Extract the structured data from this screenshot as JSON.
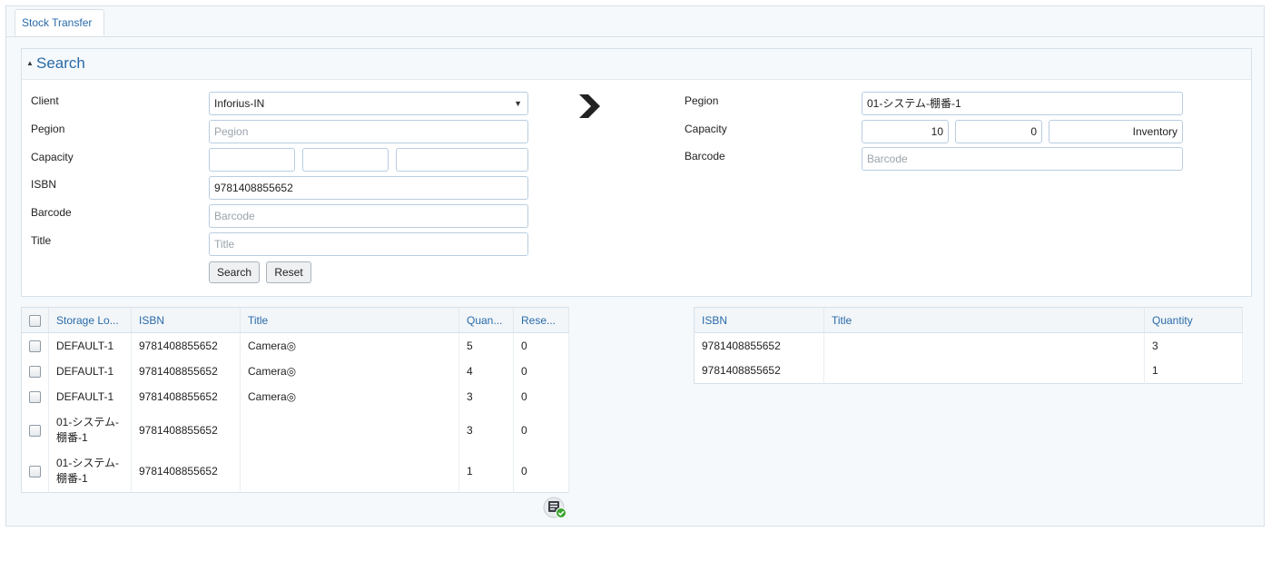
{
  "tab": {
    "label": "Stock Transfer"
  },
  "search_panel": {
    "title": "Search",
    "caret": "▲"
  },
  "left_form": {
    "client_label": "Client",
    "client_value": "Inforius-IN",
    "client_arrow": "▼",
    "pegion_label": "Pegion",
    "pegion_placeholder": "Pegion",
    "capacity_label": "Capacity",
    "isbn_label": "ISBN",
    "isbn_value": "9781408855652",
    "barcode_label": "Barcode",
    "barcode_placeholder": "Barcode",
    "title_label": "Title",
    "title_placeholder": "Title",
    "search_button": "Search",
    "reset_button": "Reset"
  },
  "right_form": {
    "pegion_label": "Pegion",
    "pegion_value": "01-システム-棚番-1",
    "capacity_label": "Capacity",
    "capacity_1": "10",
    "capacity_2": "0",
    "capacity_3": "Inventory",
    "barcode_label": "Barcode",
    "barcode_placeholder": "Barcode"
  },
  "left_table": {
    "headers": [
      "Storage Lo...",
      "ISBN",
      "Title",
      "Quan...",
      "Rese..."
    ],
    "rows": [
      {
        "storage": "DEFAULT-1",
        "isbn": "9781408855652",
        "title": "Camera◎",
        "quantity": "5",
        "reserved": "0"
      },
      {
        "storage": "DEFAULT-1",
        "isbn": "9781408855652",
        "title": "Camera◎",
        "quantity": "4",
        "reserved": "0"
      },
      {
        "storage": "DEFAULT-1",
        "isbn": "9781408855652",
        "title": "Camera◎",
        "quantity": "3",
        "reserved": "0"
      },
      {
        "storage": "01-システム-棚番-1",
        "isbn": "9781408855652",
        "title": "",
        "quantity": "3",
        "reserved": "0"
      },
      {
        "storage": "01-システム-棚番-1",
        "isbn": "9781408855652",
        "title": "",
        "quantity": "1",
        "reserved": "0"
      }
    ]
  },
  "right_table": {
    "headers": [
      "ISBN",
      "Title",
      "Quantity"
    ],
    "rows": [
      {
        "isbn": "9781408855652",
        "title": "",
        "quantity": "3"
      },
      {
        "isbn": "9781408855652",
        "title": "",
        "quantity": "1"
      }
    ]
  },
  "icons": {
    "transfer_arrow": "chevron-right-icon",
    "confirm": "document-check-icon"
  },
  "colors": {
    "accent": "#2a6aa8",
    "border": "#b9cde0",
    "confirm_green": "#3aa52f"
  }
}
